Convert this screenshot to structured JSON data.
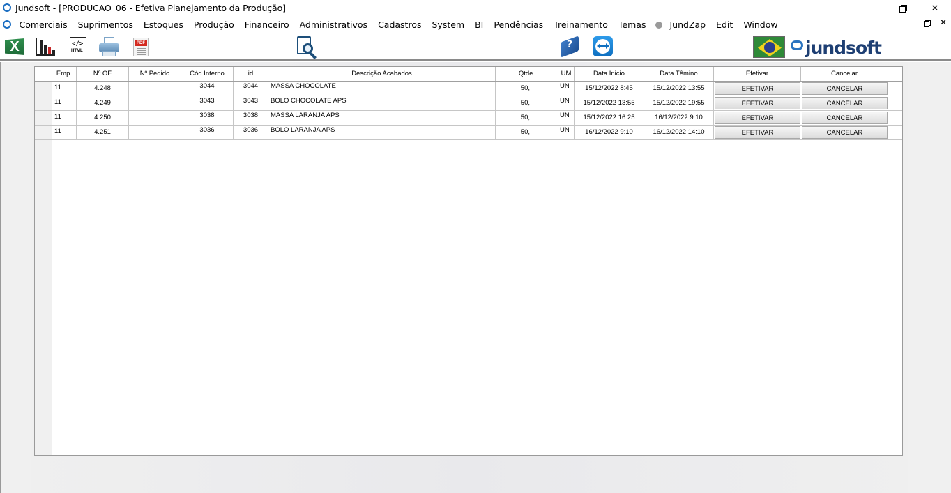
{
  "window": {
    "title": "Jundsoft - [PRODUCAO_06 - Efetiva Planejamento da Produção]"
  },
  "menu": {
    "items": [
      "Comerciais",
      "Suprimentos",
      "Estoques",
      "Produção",
      "Financeiro",
      "Administrativos",
      "Cadastros",
      "System",
      "BI",
      "Pendências",
      "Treinamento",
      "Temas"
    ],
    "after_dot": [
      "JundZap",
      "Edit",
      "Window"
    ]
  },
  "toolbar": {
    "icons": [
      "excel-icon",
      "chart-icon",
      "html-export-icon",
      "printer-icon",
      "pdf-icon",
      "search-document-icon",
      "help-book-icon",
      "teamviewer-icon",
      "brazil-flag-icon"
    ],
    "html_tag": "</>",
    "html_label": "HTML",
    "pdf_label": "PDF",
    "help_glyph": "?",
    "logo_text": "jundsoft"
  },
  "grid": {
    "headers": {
      "emp": "Emp.",
      "of": "Nº OF",
      "pedido": "Nº Pedido",
      "cod": "Cód.Interno",
      "id": "id",
      "desc": "Descrição Acabados",
      "qtde": "Qtde.",
      "um": "UM",
      "inicio": "Data Inicio",
      "termino": "Data Têmino",
      "efetivar": "Efetivar",
      "cancelar": "Cancelar"
    },
    "rows": [
      {
        "emp": "11",
        "of": "4.248",
        "pedido": "",
        "cod": "3044",
        "id": "3044",
        "desc": "MASSA CHOCOLATE",
        "qtde": "50,",
        "um": "UN",
        "inicio": "15/12/2022 8:45",
        "termino": "15/12/2022 13:55",
        "efetivar": "EFETIVAR",
        "cancelar": "CANCELAR"
      },
      {
        "emp": "11",
        "of": "4.249",
        "pedido": "",
        "cod": "3043",
        "id": "3043",
        "desc": "BOLO CHOCOLATE APS",
        "qtde": "50,",
        "um": "UN",
        "inicio": "15/12/2022 13:55",
        "termino": "15/12/2022 19:55",
        "efetivar": "EFETIVAR",
        "cancelar": "CANCELAR"
      },
      {
        "emp": "11",
        "of": "4.250",
        "pedido": "",
        "cod": "3038",
        "id": "3038",
        "desc": "MASSA LARANJA APS",
        "qtde": "50,",
        "um": "UN",
        "inicio": "15/12/2022 16:25",
        "termino": "16/12/2022 9:10",
        "efetivar": "EFETIVAR",
        "cancelar": "CANCELAR"
      },
      {
        "emp": "11",
        "of": "4.251",
        "pedido": "",
        "cod": "3036",
        "id": "3036",
        "desc": "BOLO LARANJA APS",
        "qtde": "50,",
        "um": "UN",
        "inicio": "16/12/2022 9:10",
        "termino": "16/12/2022 14:10",
        "efetivar": "EFETIVAR",
        "cancelar": "CANCELAR"
      }
    ]
  }
}
